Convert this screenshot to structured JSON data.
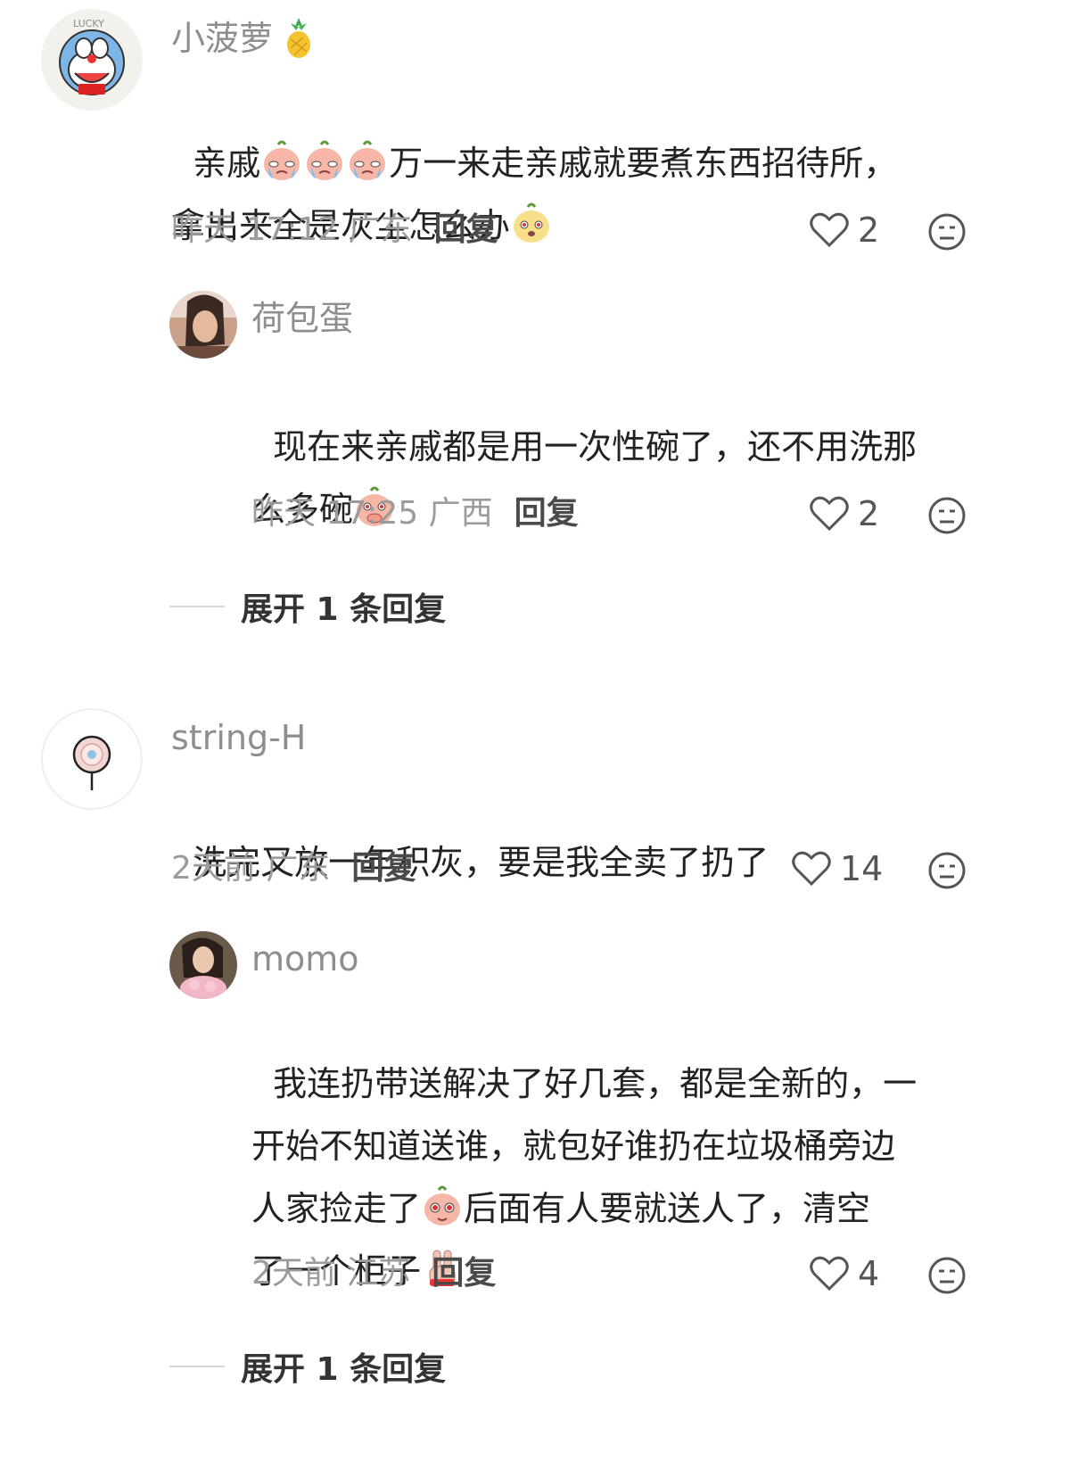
{
  "comments": [
    {
      "user": "小菠萝",
      "text_before": "亲戚",
      "text_after": "万一来走亲戚就要煮东西招待所，",
      "text_line2": "拿出来全是灰尘怎么办",
      "time": "昨天 17:12 广东",
      "reply_label": "回复",
      "likes": "2",
      "reply": {
        "user": "荷包蛋",
        "text_line1": "现在来亲戚都是用一次性碗了，还不用洗那",
        "text_line2": "么多碗",
        "time": "昨天 17:25 广西",
        "reply_label": "回复",
        "likes": "2"
      },
      "expand_label": "展开 1 条回复"
    },
    {
      "user": "string-H",
      "text": "洗完又放一年积灰，要是我全卖了扔了",
      "time": "2天前 广东",
      "reply_label": "回复",
      "likes": "14",
      "reply": {
        "user": "momo",
        "text_line1": "我连扔带送解决了好几套，都是全新的，一",
        "text_line2": "开始不知道送谁，就包好谁扔在垃圾桶旁边",
        "text_line3_before": "人家捡走了",
        "text_line3_after": "后面有人要就送人了，清空",
        "text_line4": "了一个柜子",
        "time": "2天前 江苏",
        "reply_label": "回复",
        "likes": "4"
      },
      "expand_label": "展开 1 条回复"
    }
  ],
  "icons": {
    "like": "heart-outline-icon",
    "menu": "neutral-face-icon",
    "pineapple": "pineapple-icon"
  },
  "colors": {
    "text": "#222222",
    "meta": "#9b9b9b",
    "name": "#8e8e8e"
  }
}
